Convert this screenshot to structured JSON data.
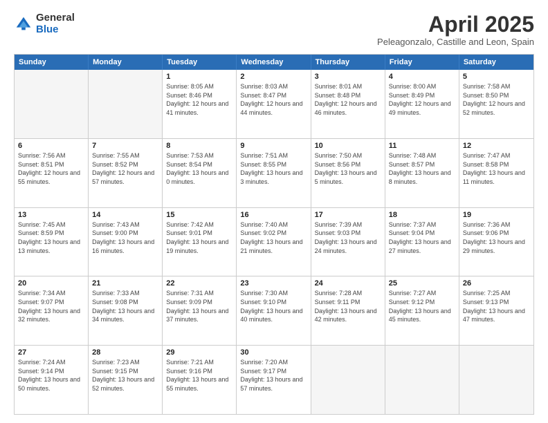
{
  "logo": {
    "general": "General",
    "blue": "Blue"
  },
  "header": {
    "month": "April 2025",
    "location": "Peleagonzalo, Castille and Leon, Spain"
  },
  "weekdays": [
    "Sunday",
    "Monday",
    "Tuesday",
    "Wednesday",
    "Thursday",
    "Friday",
    "Saturday"
  ],
  "rows": [
    [
      {
        "day": "",
        "info": "",
        "empty": true
      },
      {
        "day": "",
        "info": "",
        "empty": true
      },
      {
        "day": "1",
        "info": "Sunrise: 8:05 AM\nSunset: 8:46 PM\nDaylight: 12 hours and 41 minutes."
      },
      {
        "day": "2",
        "info": "Sunrise: 8:03 AM\nSunset: 8:47 PM\nDaylight: 12 hours and 44 minutes."
      },
      {
        "day": "3",
        "info": "Sunrise: 8:01 AM\nSunset: 8:48 PM\nDaylight: 12 hours and 46 minutes."
      },
      {
        "day": "4",
        "info": "Sunrise: 8:00 AM\nSunset: 8:49 PM\nDaylight: 12 hours and 49 minutes."
      },
      {
        "day": "5",
        "info": "Sunrise: 7:58 AM\nSunset: 8:50 PM\nDaylight: 12 hours and 52 minutes."
      }
    ],
    [
      {
        "day": "6",
        "info": "Sunrise: 7:56 AM\nSunset: 8:51 PM\nDaylight: 12 hours and 55 minutes."
      },
      {
        "day": "7",
        "info": "Sunrise: 7:55 AM\nSunset: 8:52 PM\nDaylight: 12 hours and 57 minutes."
      },
      {
        "day": "8",
        "info": "Sunrise: 7:53 AM\nSunset: 8:54 PM\nDaylight: 13 hours and 0 minutes."
      },
      {
        "day": "9",
        "info": "Sunrise: 7:51 AM\nSunset: 8:55 PM\nDaylight: 13 hours and 3 minutes."
      },
      {
        "day": "10",
        "info": "Sunrise: 7:50 AM\nSunset: 8:56 PM\nDaylight: 13 hours and 5 minutes."
      },
      {
        "day": "11",
        "info": "Sunrise: 7:48 AM\nSunset: 8:57 PM\nDaylight: 13 hours and 8 minutes."
      },
      {
        "day": "12",
        "info": "Sunrise: 7:47 AM\nSunset: 8:58 PM\nDaylight: 13 hours and 11 minutes."
      }
    ],
    [
      {
        "day": "13",
        "info": "Sunrise: 7:45 AM\nSunset: 8:59 PM\nDaylight: 13 hours and 13 minutes."
      },
      {
        "day": "14",
        "info": "Sunrise: 7:43 AM\nSunset: 9:00 PM\nDaylight: 13 hours and 16 minutes."
      },
      {
        "day": "15",
        "info": "Sunrise: 7:42 AM\nSunset: 9:01 PM\nDaylight: 13 hours and 19 minutes."
      },
      {
        "day": "16",
        "info": "Sunrise: 7:40 AM\nSunset: 9:02 PM\nDaylight: 13 hours and 21 minutes."
      },
      {
        "day": "17",
        "info": "Sunrise: 7:39 AM\nSunset: 9:03 PM\nDaylight: 13 hours and 24 minutes."
      },
      {
        "day": "18",
        "info": "Sunrise: 7:37 AM\nSunset: 9:04 PM\nDaylight: 13 hours and 27 minutes."
      },
      {
        "day": "19",
        "info": "Sunrise: 7:36 AM\nSunset: 9:06 PM\nDaylight: 13 hours and 29 minutes."
      }
    ],
    [
      {
        "day": "20",
        "info": "Sunrise: 7:34 AM\nSunset: 9:07 PM\nDaylight: 13 hours and 32 minutes."
      },
      {
        "day": "21",
        "info": "Sunrise: 7:33 AM\nSunset: 9:08 PM\nDaylight: 13 hours and 34 minutes."
      },
      {
        "day": "22",
        "info": "Sunrise: 7:31 AM\nSunset: 9:09 PM\nDaylight: 13 hours and 37 minutes."
      },
      {
        "day": "23",
        "info": "Sunrise: 7:30 AM\nSunset: 9:10 PM\nDaylight: 13 hours and 40 minutes."
      },
      {
        "day": "24",
        "info": "Sunrise: 7:28 AM\nSunset: 9:11 PM\nDaylight: 13 hours and 42 minutes."
      },
      {
        "day": "25",
        "info": "Sunrise: 7:27 AM\nSunset: 9:12 PM\nDaylight: 13 hours and 45 minutes."
      },
      {
        "day": "26",
        "info": "Sunrise: 7:25 AM\nSunset: 9:13 PM\nDaylight: 13 hours and 47 minutes."
      }
    ],
    [
      {
        "day": "27",
        "info": "Sunrise: 7:24 AM\nSunset: 9:14 PM\nDaylight: 13 hours and 50 minutes."
      },
      {
        "day": "28",
        "info": "Sunrise: 7:23 AM\nSunset: 9:15 PM\nDaylight: 13 hours and 52 minutes."
      },
      {
        "day": "29",
        "info": "Sunrise: 7:21 AM\nSunset: 9:16 PM\nDaylight: 13 hours and 55 minutes."
      },
      {
        "day": "30",
        "info": "Sunrise: 7:20 AM\nSunset: 9:17 PM\nDaylight: 13 hours and 57 minutes."
      },
      {
        "day": "",
        "info": "",
        "empty": true
      },
      {
        "day": "",
        "info": "",
        "empty": true
      },
      {
        "day": "",
        "info": "",
        "empty": true
      }
    ]
  ]
}
